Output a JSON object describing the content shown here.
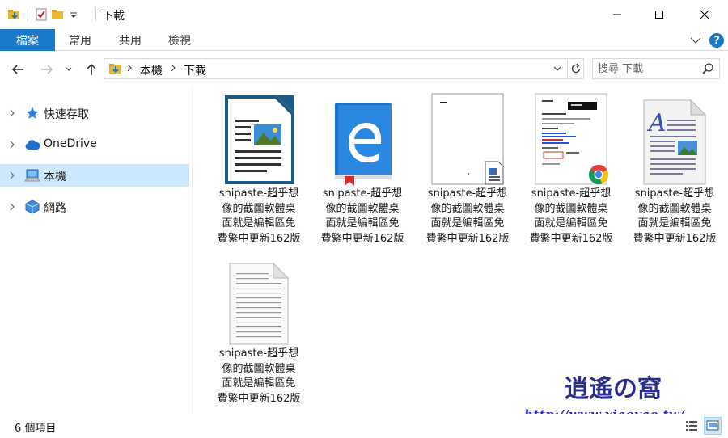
{
  "window": {
    "title": "下載",
    "controls": {
      "minimize": "minimize",
      "maximize": "maximize",
      "close": "close"
    }
  },
  "ribbon": {
    "file_tab": "檔案",
    "tabs": [
      {
        "label": "常用"
      },
      {
        "label": "共用"
      },
      {
        "label": "檢視"
      }
    ],
    "help_label": "?"
  },
  "address": {
    "breadcrumbs": [
      "本機",
      "下載"
    ]
  },
  "search": {
    "placeholder": "搜尋 下載"
  },
  "nav": {
    "items": [
      {
        "label": "快速存取",
        "icon": "star-icon"
      },
      {
        "label": "OneDrive",
        "icon": "cloud-icon"
      },
      {
        "label": "本機",
        "icon": "computer-icon",
        "selected": true
      },
      {
        "label": "網路",
        "icon": "network-icon"
      }
    ]
  },
  "files": [
    {
      "name_lines": [
        "snipaste-超乎想",
        "像的截圖軟體桌",
        "面就是編輯區免",
        "費繁中更新162版"
      ],
      "icon": "libreoffice-writer-icon"
    },
    {
      "name_lines": [
        "snipaste-超乎想",
        "像的截圖軟體桌",
        "面就是編輯區免",
        "費繁中更新162版"
      ],
      "icon": "edge-ebook-icon"
    },
    {
      "name_lines": [
        "snipaste-超乎想",
        "像的截圖軟體桌",
        "面就是編輯區免",
        "費繁中更新162版"
      ],
      "icon": "word-document-thumbnail-icon"
    },
    {
      "name_lines": [
        "snipaste-超乎想",
        "像的截圖軟體桌",
        "面就是編輯區免",
        "費繁中更新162版"
      ],
      "icon": "chrome-pdf-thumbnail-icon"
    },
    {
      "name_lines": [
        "snipaste-超乎想",
        "像的截圖軟體桌",
        "面就是編輯區免",
        "費繁中更新162版"
      ],
      "icon": "wordpad-document-icon"
    },
    {
      "name_lines": [
        "snipaste-超乎想",
        "像的截圖軟體桌",
        "面就是編輯區免",
        "費繁中更新162版"
      ],
      "icon": "text-document-icon"
    }
  ],
  "status": {
    "item_count": "6 個項目"
  },
  "watermark": {
    "logo": "逍遙の窩",
    "url": "http://www.xiaoyao.tw/"
  },
  "colors": {
    "accent": "#1979ca",
    "selected_bg": "#cce8ff"
  }
}
